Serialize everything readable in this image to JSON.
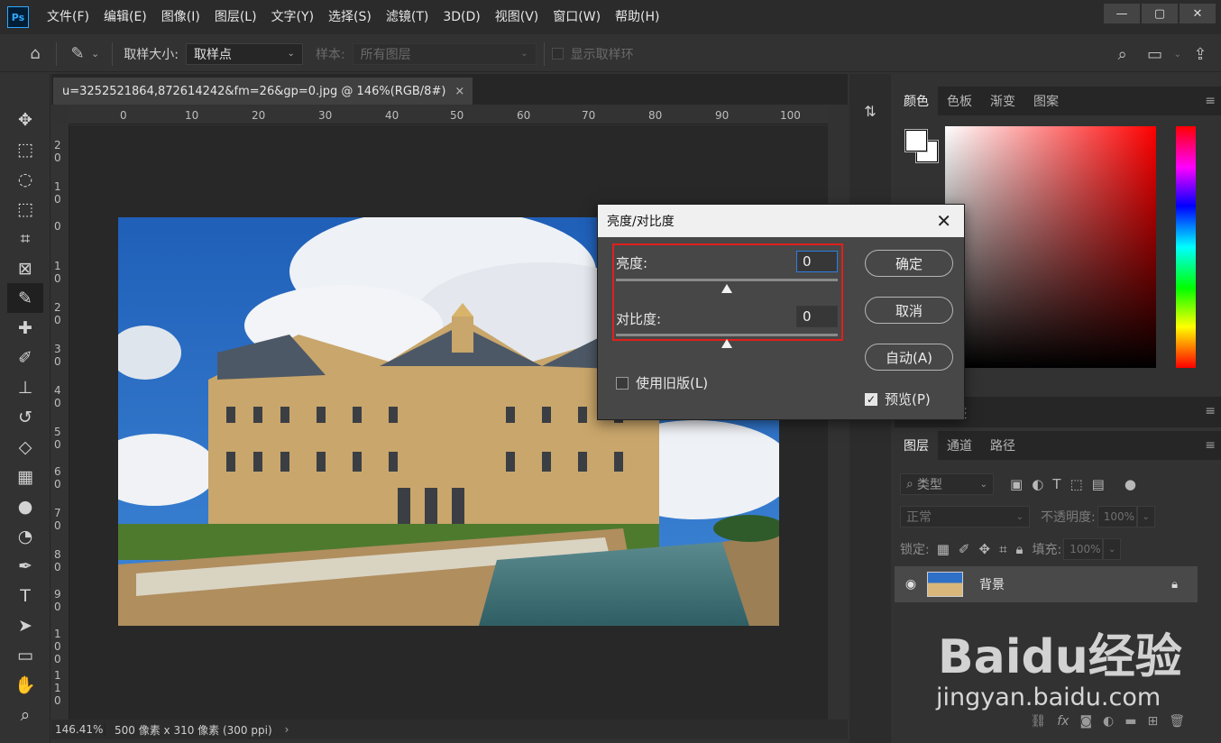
{
  "app": {
    "logo": "Ps",
    "menu": [
      "文件(F)",
      "编辑(E)",
      "图像(I)",
      "图层(L)",
      "文字(Y)",
      "选择(S)",
      "滤镜(T)",
      "3D(D)",
      "视图(V)",
      "窗口(W)",
      "帮助(H)"
    ],
    "window_controls": [
      "—",
      "▢",
      "✕"
    ]
  },
  "options_bar": {
    "sample_size_label": "取样大小:",
    "sample_size_value": "取样点",
    "sample_label": "样本:",
    "sample_value": "所有图层",
    "show_ring_label": "显示取样环"
  },
  "document": {
    "tab_title": "u=3252521864,872614242&fm=26&gp=0.jpg @ 146%(RGB/8#)",
    "tab_close": "×",
    "ruler_top": [
      "0",
      "10",
      "20",
      "30",
      "40",
      "50",
      "60",
      "70",
      "80",
      "90",
      "100"
    ],
    "ruler_left": [
      "2 0",
      "1 0",
      "0",
      "1 0",
      "2 0",
      "3 0",
      "4 0",
      "5 0",
      "6 0",
      "7 0",
      "8 0",
      "9 0",
      "1 0 0",
      "1 1 0"
    ],
    "zoom": "146.41%",
    "info": "500 像素 x 310 像素 (300 ppi)",
    "status_arrow": "›"
  },
  "color_panel": {
    "tabs": [
      "颜色",
      "色板",
      "渐变",
      "图案"
    ],
    "active_tab": 0,
    "foreground": "#ffffff",
    "background": "#ffffff"
  },
  "mid_panel": {
    "label": "整"
  },
  "layers_panel": {
    "tabs": [
      "图层",
      "通道",
      "路径"
    ],
    "filter_placeholder": "类型",
    "blend_mode": "正常",
    "opacity_label": "不透明度:",
    "opacity_value": "100%",
    "lock_label": "锁定:",
    "fill_label": "填充:",
    "fill_value": "100%",
    "layers": [
      {
        "name": "背景",
        "visible": true,
        "locked": true
      }
    ]
  },
  "dialog": {
    "title": "亮度/对比度",
    "brightness_label": "亮度:",
    "brightness_value": "0",
    "contrast_label": "对比度:",
    "contrast_value": "0",
    "legacy_label": "使用旧版(L)",
    "legacy_checked": false,
    "ok_label": "确定",
    "cancel_label": "取消",
    "auto_label": "自动(A)",
    "preview_label": "预览(P)",
    "preview_checked": true,
    "highlight_color": "#e0201c"
  },
  "watermark": {
    "logo_text": "Baidu经验",
    "url": "jingyan.baidu.com"
  }
}
